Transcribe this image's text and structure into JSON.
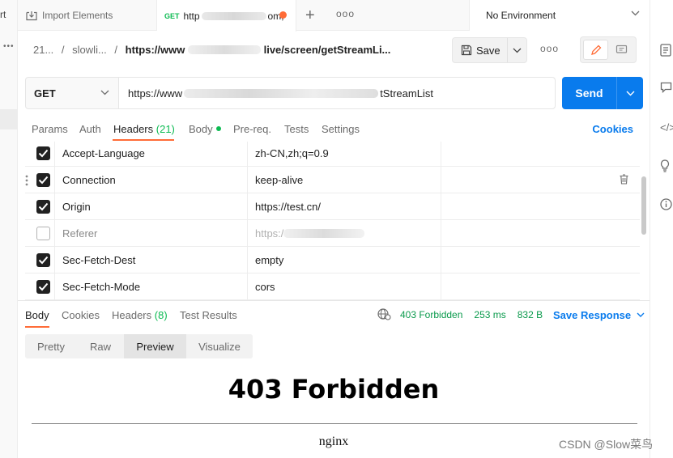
{
  "left_strip": {
    "cut_label": "rt"
  },
  "tabbar": {
    "import_tab": {
      "label": "Import Elements",
      "icon": "import-icon"
    },
    "request_tab": {
      "method": "GET",
      "url_prefix": "http",
      "url_suffix": "om,",
      "unsaved_indicator_color": "#ff6c37"
    },
    "new_tab_icon": "plus-icon",
    "more_label": "ooo",
    "environment": {
      "label": "No Environment"
    }
  },
  "breadcrumb": {
    "collection": "21...",
    "folder": "slowli...",
    "request_prefix": "https://www",
    "request_suffix": "live/screen/getStreamLi..."
  },
  "save": {
    "label": "Save"
  },
  "request": {
    "method": "GET",
    "url_prefix": "https://www",
    "url_suffix": "tStreamList",
    "send_label": "Send"
  },
  "request_tabs": {
    "params": "Params",
    "auth": "Auth",
    "headers": "Headers",
    "headers_count": "(21)",
    "body": "Body",
    "prereq": "Pre-req.",
    "tests": "Tests",
    "settings": "Settings",
    "cookies": "Cookies"
  },
  "headers": [
    {
      "key": "Accept-Language",
      "value": "zh-CN,zh;q=0.9",
      "checked": true
    },
    {
      "key": "Connection",
      "value": "keep-alive",
      "checked": true
    },
    {
      "key": "Origin",
      "value": "https://test.cn/",
      "checked": true
    },
    {
      "key": "Referer",
      "value": "https:/",
      "checked": false
    },
    {
      "key": "Sec-Fetch-Dest",
      "value": "empty",
      "checked": true
    },
    {
      "key": "Sec-Fetch-Mode",
      "value": "cors",
      "checked": true
    }
  ],
  "response_tabs": {
    "body": "Body",
    "cookies": "Cookies",
    "headers": "Headers",
    "headers_count": "(8)",
    "test_results": "Test Results"
  },
  "response_status": {
    "status": "403 Forbidden",
    "time": "253 ms",
    "size": "832 B",
    "save_response": "Save Response"
  },
  "view_modes": {
    "pretty": "Pretty",
    "raw": "Raw",
    "preview": "Preview",
    "visualize": "Visualize",
    "selected": "Preview"
  },
  "preview": {
    "title": "403 Forbidden",
    "server": "nginx"
  },
  "watermark": "CSDN @Slow菜鸟",
  "colors": {
    "accent": "#ff6c37",
    "primary": "#097bed",
    "success": "#0cbb52"
  }
}
